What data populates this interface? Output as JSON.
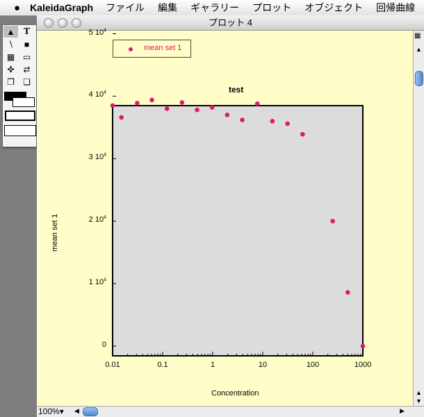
{
  "menubar": {
    "app_name": "KaleidaGraph",
    "items": [
      "ファイル",
      "編集",
      "ギャラリー",
      "プロット",
      "オブジェクト",
      "回帰曲線"
    ]
  },
  "window": {
    "title": "プロット 4",
    "zoom": "100%"
  },
  "legend": {
    "label": "mean set 1"
  },
  "chart_data": {
    "type": "scatter",
    "title": "test",
    "xlabel": "Concentration",
    "ylabel": "mean set 1",
    "x_scale": "log",
    "xlim": [
      0.01,
      1000
    ],
    "ylim": [
      0,
      50000
    ],
    "x_ticks": [
      "0.01",
      "0.1",
      "1",
      "10",
      "100",
      "1000"
    ],
    "y_ticks": [
      {
        "value": 0,
        "mant": "0",
        "exp": ""
      },
      {
        "value": 10000,
        "mant": "1 10",
        "exp": "4"
      },
      {
        "value": 20000,
        "mant": "2 10",
        "exp": "4"
      },
      {
        "value": 30000,
        "mant": "3 10",
        "exp": "4"
      },
      {
        "value": 40000,
        "mant": "4 10",
        "exp": "4"
      },
      {
        "value": 50000,
        "mant": "5 10",
        "exp": "4"
      }
    ],
    "marker_color": "#e0196f",
    "plot_bg": "#dcdcdc",
    "series": [
      {
        "name": "mean set 1",
        "x": [
          0.01,
          0.015,
          0.031,
          0.061,
          0.122,
          0.244,
          0.488,
          0.977,
          1.95,
          3.9,
          7.8,
          15.6,
          31.25,
          62.5,
          250,
          500,
          1000
        ],
        "y": [
          38500,
          36600,
          38900,
          39400,
          38000,
          39000,
          37800,
          38200,
          37000,
          36200,
          38800,
          36000,
          35600,
          33900,
          20000,
          8600,
          0
        ]
      }
    ]
  }
}
